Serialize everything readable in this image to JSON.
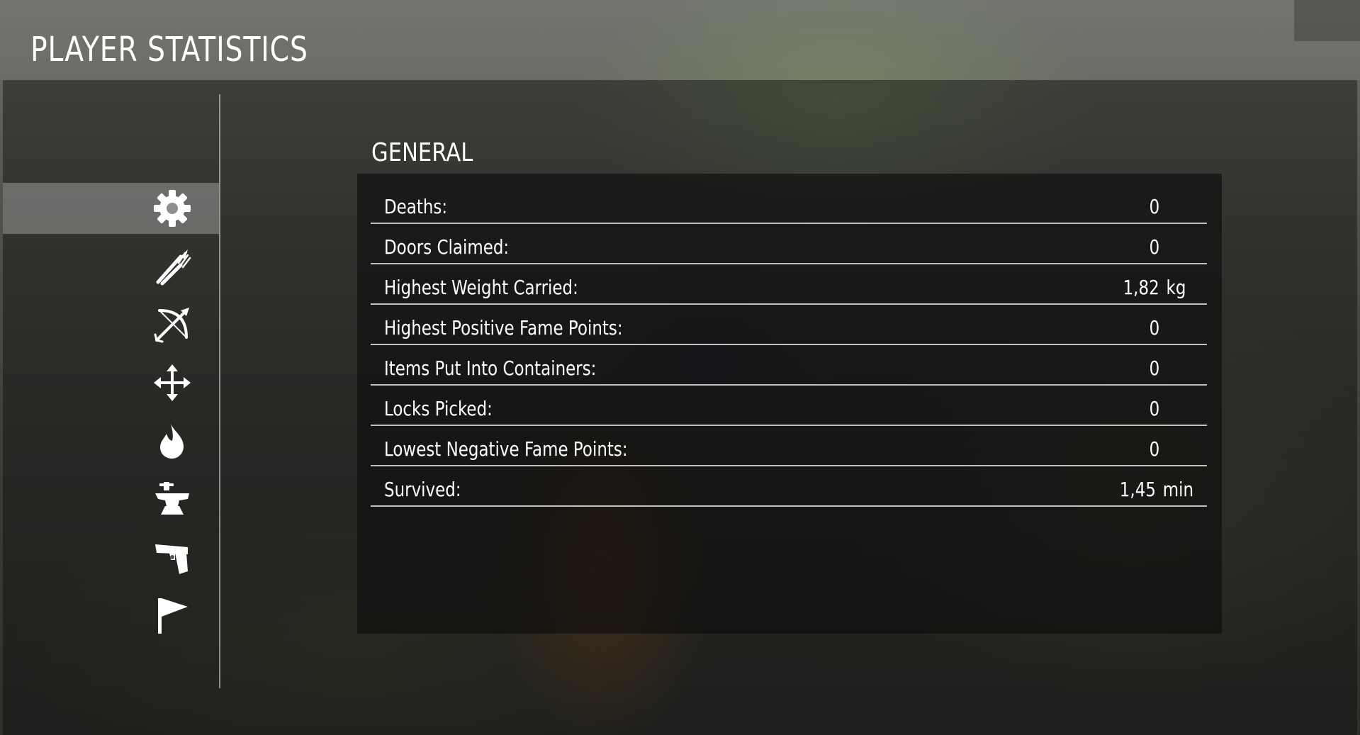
{
  "header": {
    "title": "PLAYER STATISTICS"
  },
  "sidebar": {
    "items": [
      {
        "icon": "gear-icon",
        "active": true
      },
      {
        "icon": "fork-knife-icon",
        "active": false
      },
      {
        "icon": "bow-arrow-icon",
        "active": false
      },
      {
        "icon": "move-arrows-icon",
        "active": false
      },
      {
        "icon": "flame-icon",
        "active": false
      },
      {
        "icon": "anvil-icon",
        "active": false
      },
      {
        "icon": "pistol-icon",
        "active": false
      },
      {
        "icon": "flag-icon",
        "active": false
      }
    ]
  },
  "section": {
    "title": "GENERAL"
  },
  "stats": [
    {
      "label": "Deaths:",
      "value": "0",
      "unit": ""
    },
    {
      "label": "Doors Claimed:",
      "value": "0",
      "unit": ""
    },
    {
      "label": "Highest Weight Carried:",
      "value": "1,82",
      "unit": "kg"
    },
    {
      "label": "Highest Positive Fame Points:",
      "value": "0",
      "unit": ""
    },
    {
      "label": "Items Put Into Containers:",
      "value": "0",
      "unit": ""
    },
    {
      "label": "Locks Picked:",
      "value": "0",
      "unit": ""
    },
    {
      "label": "Lowest Negative Fame Points:",
      "value": "0",
      "unit": ""
    },
    {
      "label": "Survived:",
      "value": "1,45",
      "unit": "min"
    }
  ],
  "colors": {
    "text": "#ffffff",
    "active_tab": "#9a9a96",
    "divider": "#e6e6e6"
  }
}
